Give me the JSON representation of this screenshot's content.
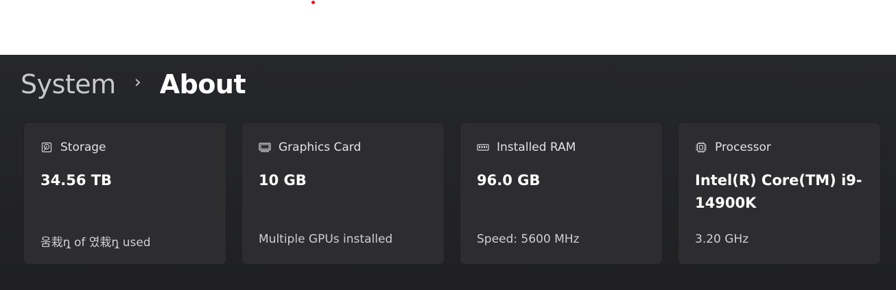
{
  "breadcrumb": {
    "parent": "System",
    "separator": "›",
    "current": "About"
  },
  "cards": [
    {
      "icon": "hard-drive-icon",
      "label": "Storage",
      "value": "34.56 TB",
      "sub": "움栽ɳ̧ of 였栽ɳ̧ used"
    },
    {
      "icon": "monitor-icon",
      "label": "Graphics Card",
      "value": "10 GB",
      "sub": "Multiple GPUs installed"
    },
    {
      "icon": "ram-icon",
      "label": "Installed RAM",
      "value": "96.0 GB",
      "sub": "Speed: 5600 MHz"
    },
    {
      "icon": "processor-icon",
      "label": "Processor",
      "value": "Intel(R) Core(TM) i9-14900K",
      "sub": "3.20 GHz"
    }
  ],
  "colors": {
    "background": "#202023",
    "card": "#2d2d30",
    "accent_dot": "#e81123"
  }
}
